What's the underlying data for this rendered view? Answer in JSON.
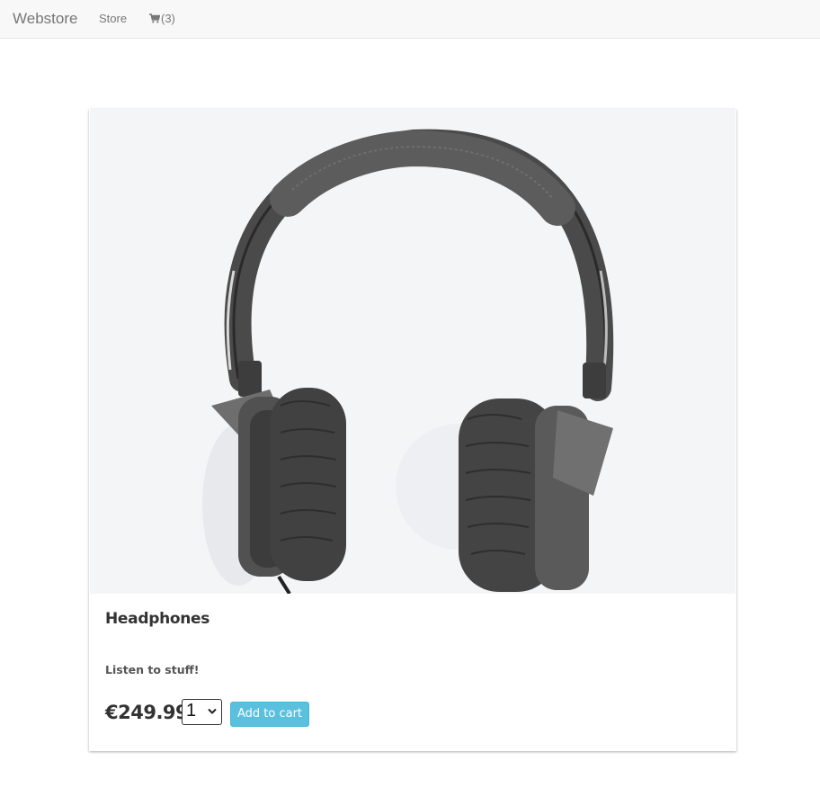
{
  "navbar": {
    "brand": "Webstore",
    "store_link": "Store",
    "cart_icon": "shopping-cart-icon",
    "cart_count": "(3)"
  },
  "product": {
    "image_icon": "headphones-photo",
    "name": "Headphones",
    "description": "Listen to stuff!",
    "price": "€249.99",
    "quantity": "1",
    "add_to_cart_label": "Add to cart"
  },
  "colors": {
    "navbar_bg": "#f8f8f8",
    "button_bg": "#5bc0de",
    "image_bg": "#f4f5f7"
  }
}
